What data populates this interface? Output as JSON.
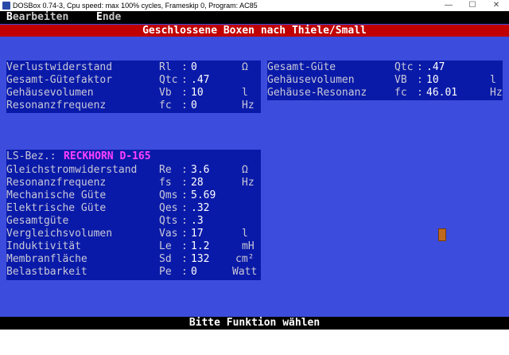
{
  "window": {
    "title": "DOSBox 0.74-3, Cpu speed: max 100% cycles, Frameskip  0, Program:    AC85",
    "minimize": "—",
    "maximize": "☐",
    "close": "✕"
  },
  "menu": [
    {
      "hotkey": "B",
      "rest": "earbeiten"
    },
    {
      "hotkey": "E",
      "rest": "nde"
    }
  ],
  "header": {
    "title": "Geschlossene Boxen nach Thiele/Small"
  },
  "panel_left": [
    {
      "label": "Verlustwiderstand",
      "sym": "Rl",
      "sep": ":",
      "value": "0",
      "unit": "Ω"
    },
    {
      "label": "Gesamt-Gütefaktor",
      "sym": "Qtc",
      "sep": ":",
      "value": ".47",
      "unit": ""
    },
    {
      "label": "Gehäusevolumen",
      "sym": "Vb",
      "sep": ":",
      "value": "10",
      "unit": "l"
    },
    {
      "label": "Resonanzfrequenz",
      "sym": "fc",
      "sep": ":",
      "value": "0",
      "unit": "Hz"
    }
  ],
  "panel_right": [
    {
      "label": "Gesamt-Güte",
      "sym": "Qtc",
      "sep": ":",
      "value": ".47",
      "unit": ""
    },
    {
      "label": "Gehäusevolumen",
      "sym": "VB",
      "sep": ":",
      "value": "10",
      "unit": "l"
    },
    {
      "label": "Gehäuse-Resonanz",
      "sym": "fc",
      "sep": ":",
      "value": "46.01",
      "unit": "Hz"
    }
  ],
  "speaker": {
    "label": "LS-Bez.:",
    "name": "RECKHORN D-165",
    "params": [
      {
        "label": "Gleichstromwiderstand",
        "sym": "Re",
        "sep": ":",
        "value": "3.6",
        "unit": "Ω"
      },
      {
        "label": "Resonanzfrequenz",
        "sym": "fs",
        "sep": ":",
        "value": "28",
        "unit": "Hz"
      },
      {
        "label": "Mechanische Güte",
        "sym": "Qms",
        "sep": ":",
        "value": "5.69",
        "unit": ""
      },
      {
        "label": "Elektrische Güte",
        "sym": "Qes",
        "sep": ":",
        "value": ".32",
        "unit": ""
      },
      {
        "label": "Gesamtgüte",
        "sym": "Qts",
        "sep": ":",
        "value": ".3",
        "unit": ""
      },
      {
        "label": "Vergleichsvolumen",
        "sym": "Vas",
        "sep": ":",
        "value": "17",
        "unit": "l"
      },
      {
        "label": "Induktivität",
        "sym": "Le",
        "sep": ":",
        "value": "1.2",
        "unit": "mH"
      },
      {
        "label": "Membranfläche",
        "sym": "Sd",
        "sep": ":",
        "value": "132",
        "unit": "cm²"
      },
      {
        "label": "Belastbarkeit",
        "sym": "Pe",
        "sep": ":",
        "value": "0",
        "unit": "Watt"
      }
    ]
  },
  "status": {
    "text": "Bitte Funktion wählen"
  }
}
